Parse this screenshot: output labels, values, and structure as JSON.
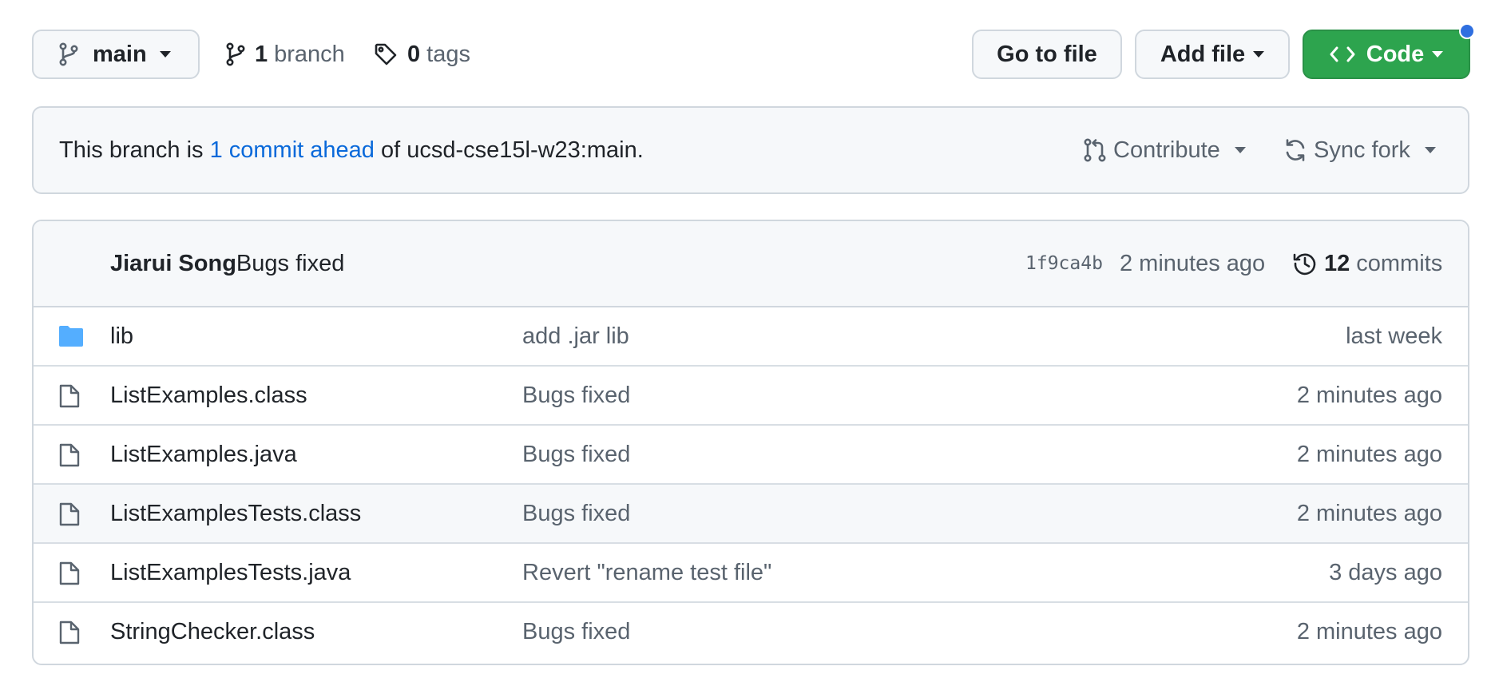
{
  "toolbar": {
    "branch_name": "main",
    "branch_count": "1",
    "branch_label": "branch",
    "tag_count": "0",
    "tag_label": "tags",
    "go_to_file_label": "Go to file",
    "add_file_label": "Add file",
    "code_label": "Code"
  },
  "banner": {
    "prefix": "This branch is ",
    "link_text": "1 commit ahead",
    "suffix": " of ucsd-cse15l-w23:main.",
    "contribute_label": "Contribute",
    "sync_fork_label": "Sync fork"
  },
  "latest_commit": {
    "author": "Jiarui Song",
    "message": "Bugs fixed",
    "sha": "1f9ca4b",
    "time": "2 minutes ago",
    "commit_count": "12",
    "commit_label": "commits"
  },
  "files": [
    {
      "type": "folder",
      "name": "lib",
      "message": "add .jar lib",
      "age": "last week"
    },
    {
      "type": "file",
      "name": "ListExamples.class",
      "message": "Bugs fixed",
      "age": "2 minutes ago"
    },
    {
      "type": "file",
      "name": "ListExamples.java",
      "message": "Bugs fixed",
      "age": "2 minutes ago"
    },
    {
      "type": "file",
      "name": "ListExamplesTests.class",
      "message": "Bugs fixed",
      "age": "2 minutes ago"
    },
    {
      "type": "file",
      "name": "ListExamplesTests.java",
      "message": "Revert \"rename test file\"",
      "age": "3 days ago"
    },
    {
      "type": "file",
      "name": "StringChecker.class",
      "message": "Bugs fixed",
      "age": "2 minutes ago"
    }
  ],
  "colors": {
    "accent_link": "#0969da",
    "code_button": "#2da44e",
    "folder_icon": "#54aeff",
    "notification_dot": "#2f6fe0"
  }
}
